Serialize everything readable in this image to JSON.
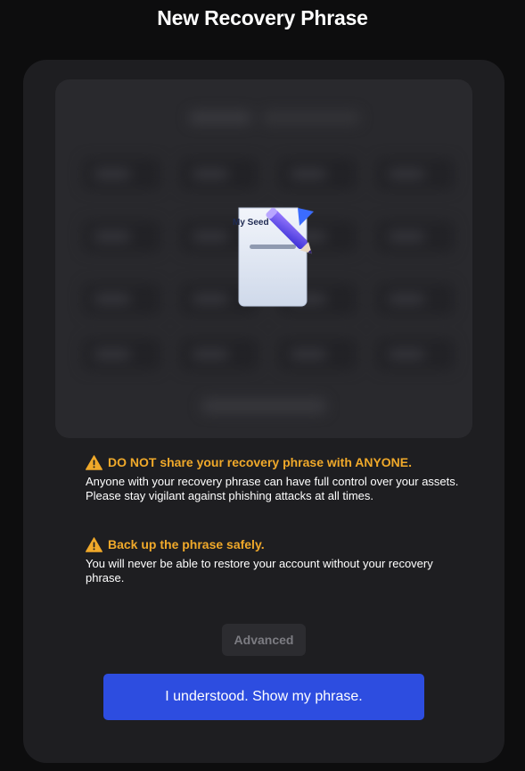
{
  "header": {
    "title": "New Recovery Phrase"
  },
  "illustration": {
    "label": "My Seed",
    "icon": "seed-document-pencil-icon"
  },
  "warnings": [
    {
      "icon": "warning-icon",
      "heading": "DO NOT share your recovery phrase with ANYONE.",
      "body": "Anyone with your recovery phrase can have full control over your assets. Please stay vigilant against phishing attacks at all times."
    },
    {
      "icon": "warning-icon",
      "heading": "Back up the phrase safely.",
      "body": "You will never be able to restore your account without your recovery phrase."
    }
  ],
  "actions": {
    "advanced_label": "Advanced",
    "primary_label": "I understood. Show my phrase."
  },
  "colors": {
    "background": "#0d0d0e",
    "card": "#1e1e21",
    "warning": "#f0a92a",
    "primary": "#2d4de0"
  }
}
